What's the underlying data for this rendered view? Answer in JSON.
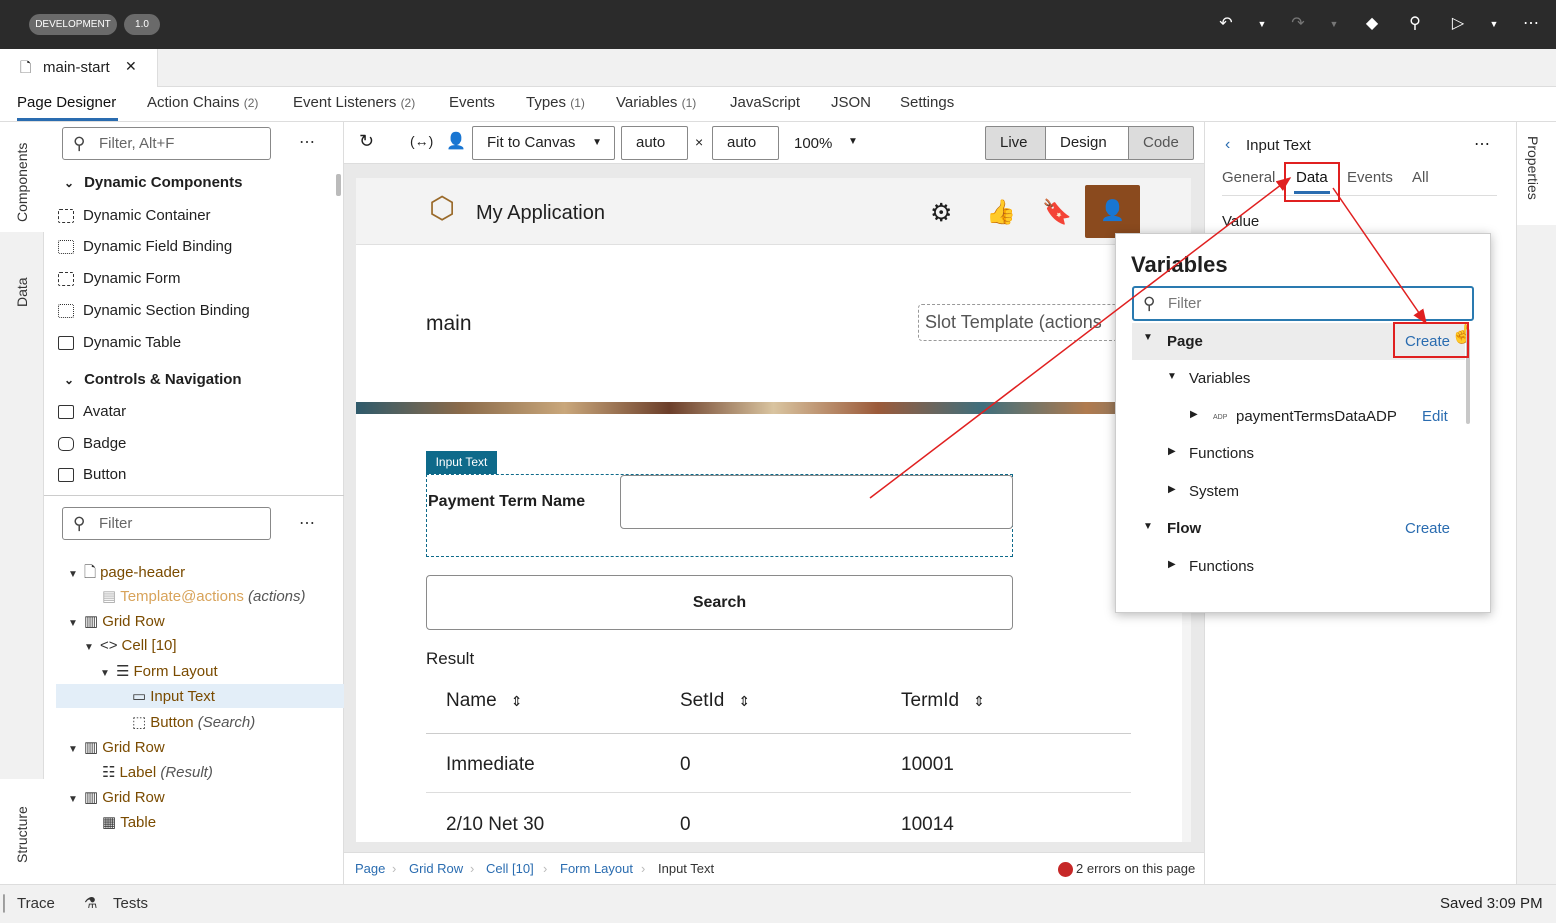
{
  "topbar": {
    "env_badge": "DEVELOPMENT",
    "version_badge": "1.0"
  },
  "file_tab": {
    "label": "main-start",
    "close": "✕"
  },
  "nav_tabs": [
    {
      "label": "Page Designer",
      "count": ""
    },
    {
      "label": "Action Chains",
      "count": "(2)"
    },
    {
      "label": "Event Listeners",
      "count": "(2)"
    },
    {
      "label": "Events",
      "count": ""
    },
    {
      "label": "Types",
      "count": "(1)"
    },
    {
      "label": "Variables",
      "count": "(1)"
    },
    {
      "label": "JavaScript",
      "count": ""
    },
    {
      "label": "JSON",
      "count": ""
    },
    {
      "label": "Settings",
      "count": ""
    }
  ],
  "left_rail": {
    "components": "Components",
    "data": "Data",
    "structure": "Structure"
  },
  "components_panel": {
    "filter_placeholder": "Filter, Alt+F",
    "groups": [
      {
        "title": "Dynamic Components",
        "items": [
          "Dynamic Container",
          "Dynamic Field Binding",
          "Dynamic Form",
          "Dynamic Section Binding",
          "Dynamic Table"
        ]
      },
      {
        "title": "Controls & Navigation",
        "items": [
          "Avatar",
          "Badge",
          "Button"
        ]
      }
    ]
  },
  "structure_panel": {
    "filter_placeholder": "Filter",
    "nodes": [
      {
        "label": "page-header",
        "note": ""
      },
      {
        "label": "Template",
        "accent": "@actions",
        "note": "(actions)"
      },
      {
        "label": "Grid Row",
        "note": ""
      },
      {
        "label": "Cell [10]",
        "note": ""
      },
      {
        "label": "Form Layout",
        "note": ""
      },
      {
        "label": "Input Text",
        "note": ""
      },
      {
        "label": "Button",
        "note": "(Search)"
      },
      {
        "label": "Grid Row",
        "note": ""
      },
      {
        "label": "Label",
        "note": "(Result)"
      },
      {
        "label": "Grid Row",
        "note": ""
      },
      {
        "label": "Table",
        "note": ""
      }
    ]
  },
  "canvas_toolbar": {
    "fit": "Fit to Canvas",
    "width": "auto",
    "times": "×",
    "height": "auto",
    "zoom": "100%",
    "modes": [
      "Live",
      "Design",
      "Code"
    ]
  },
  "app": {
    "title": "My Application",
    "page_title": "main",
    "slot": "Slot Template (actions",
    "input_badge": "Input Text",
    "field_label": "Payment Term Name",
    "search_button": "Search",
    "result_label": "Result",
    "columns": [
      "Name",
      "SetId",
      "TermId"
    ],
    "rows": [
      [
        "Immediate",
        "0",
        "10001"
      ],
      [
        "2/10 Net 30",
        "0",
        "10014"
      ]
    ]
  },
  "breadcrumb": {
    "items": [
      "Page",
      "Grid Row",
      "Cell [10]",
      "Form Layout",
      "Input Text"
    ],
    "errors": "2 errors on this page"
  },
  "properties": {
    "title": "Input Text",
    "tabs": [
      "General",
      "Data",
      "Events",
      "All"
    ],
    "value_label": "Value",
    "rail_label": "Properties"
  },
  "variables_popup": {
    "title": "Variables",
    "filter_placeholder": "Filter",
    "page": "Page",
    "create": "Create",
    "variables": "Variables",
    "adp_tag": "ADP",
    "variable": "paymentTermsDataADP",
    "edit": "Edit",
    "functions": "Functions",
    "system": "System",
    "flow": "Flow",
    "flow_create": "Create",
    "flow_functions": "Functions"
  },
  "statusbar": {
    "trace": "Trace",
    "tests": "Tests",
    "saved": "Saved 3:09 PM"
  },
  "colors": {
    "accent": "#2a6cb0",
    "annotation": "#e02020",
    "topbar": "#2b2b2b",
    "badge": "#0e6a8a"
  }
}
